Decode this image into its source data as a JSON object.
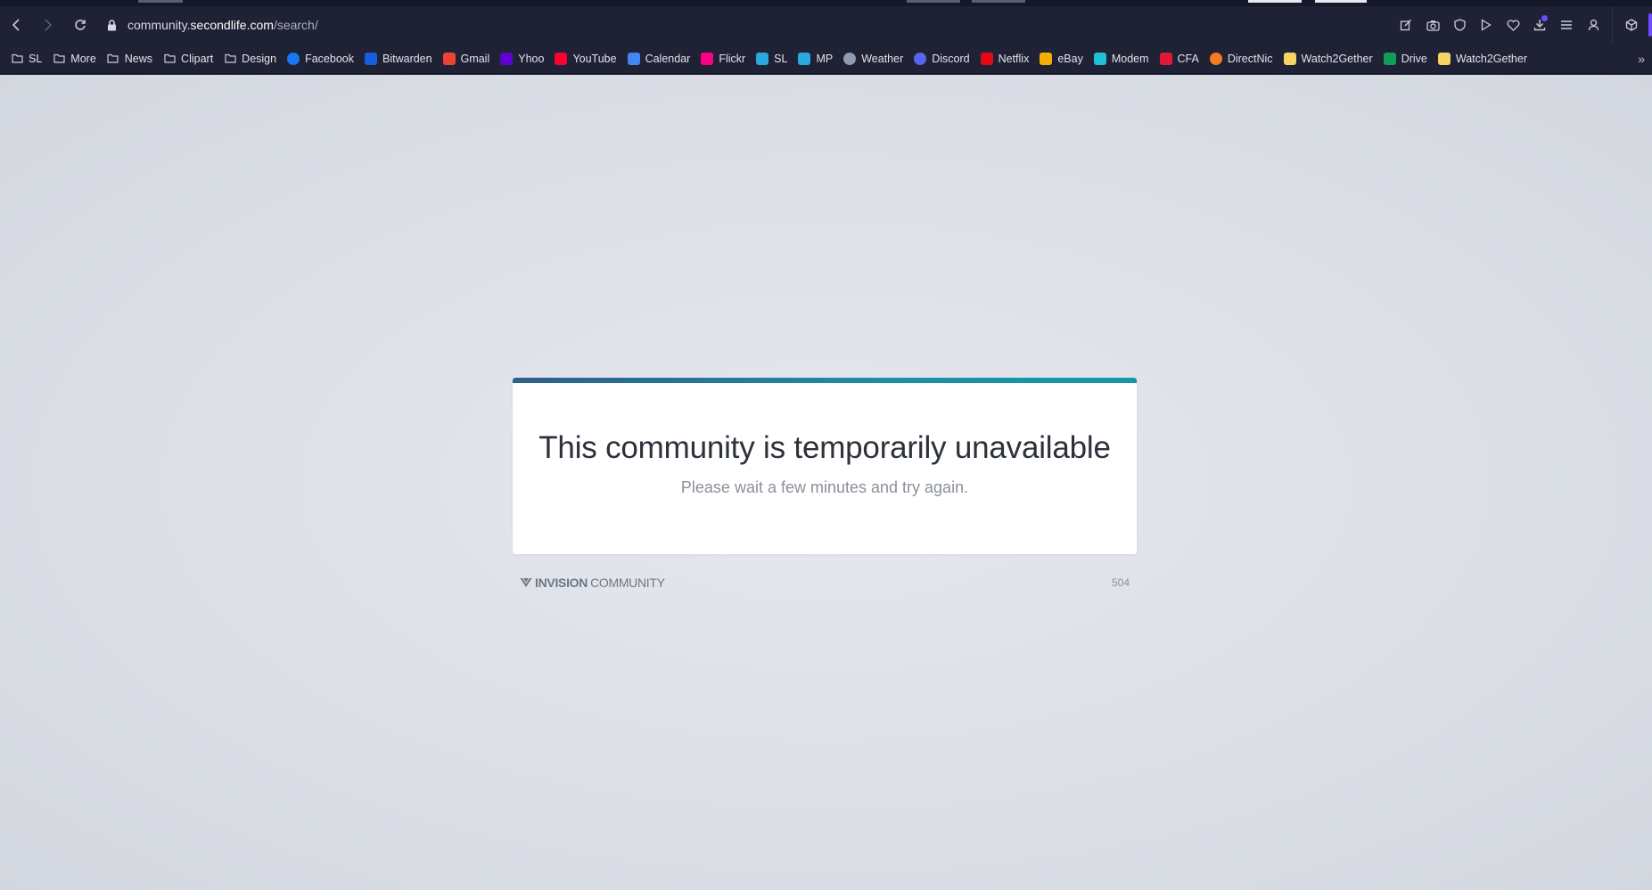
{
  "browser": {
    "address": {
      "prefix": "community.",
      "host": "secondlife.com",
      "path": "/search/"
    },
    "bookmarks": [
      {
        "label": "SL",
        "icon": "folder-icon",
        "color": "#c9cbd6"
      },
      {
        "label": "More",
        "icon": "folder-icon",
        "color": "#c9cbd6"
      },
      {
        "label": "News",
        "icon": "folder-icon",
        "color": "#c9cbd6"
      },
      {
        "label": "Clipart",
        "icon": "folder-icon",
        "color": "#c9cbd6"
      },
      {
        "label": "Design",
        "icon": "folder-icon",
        "color": "#c9cbd6"
      },
      {
        "label": "Facebook",
        "icon": "facebook-icon",
        "color": "#1877f2"
      },
      {
        "label": "Bitwarden",
        "icon": "bitwarden-icon",
        "color": "#175ddc"
      },
      {
        "label": "Gmail",
        "icon": "gmail-icon",
        "color": "#ea4335"
      },
      {
        "label": "Yhoo",
        "icon": "yahoo-icon",
        "color": "#6001d2"
      },
      {
        "label": "YouTube",
        "icon": "youtube-icon",
        "color": "#ff0033"
      },
      {
        "label": "Calendar",
        "icon": "calendar-icon",
        "color": "#4285f4"
      },
      {
        "label": "Flickr",
        "icon": "flickr-icon",
        "color": "#ff0084"
      },
      {
        "label": "SL",
        "icon": "secondlife-icon",
        "color": "#2aa9e0"
      },
      {
        "label": "MP",
        "icon": "secondlife-mp-icon",
        "color": "#2aa9e0"
      },
      {
        "label": "Weather",
        "icon": "weather-icon",
        "color": "#8e9bb0"
      },
      {
        "label": "Discord",
        "icon": "discord-icon",
        "color": "#5865f2"
      },
      {
        "label": "Netflix",
        "icon": "netflix-icon",
        "color": "#e50914"
      },
      {
        "label": "eBay",
        "icon": "ebay-icon",
        "color": "#f5af02"
      },
      {
        "label": "Modem",
        "icon": "modem-icon",
        "color": "#1ec0d8"
      },
      {
        "label": "CFA",
        "icon": "cfa-icon",
        "color": "#e31837"
      },
      {
        "label": "DirectNic",
        "icon": "directnic-icon",
        "color": "#f47b20"
      },
      {
        "label": "Watch2Gether",
        "icon": "watch2gether-icon",
        "color": "#f6d365"
      },
      {
        "label": "Drive",
        "icon": "drive-icon",
        "color": "#0f9d58"
      },
      {
        "label": "Watch2Gether",
        "icon": "watch2gether-icon",
        "color": "#f6d365"
      }
    ]
  },
  "error": {
    "title": "This community is temporarily unavailable",
    "message": "Please wait a few minutes and try again.",
    "brand_bold": "INVISION",
    "brand_normal": "COMMUNITY",
    "code": "504"
  }
}
